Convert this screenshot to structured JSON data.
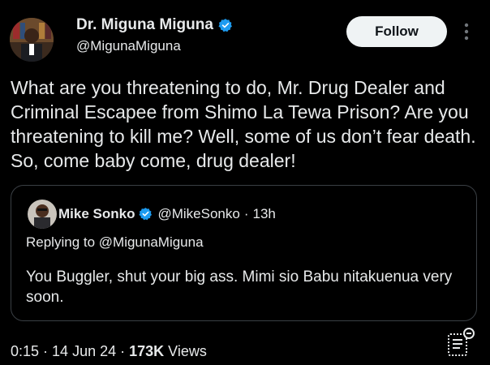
{
  "author": {
    "name": "Dr. Miguna Miguna",
    "handle": "@MigunaMiguna",
    "verified_icon": "verified-badge-icon"
  },
  "actions": {
    "follow_label": "Follow",
    "more_icon": "more-vertical-icon"
  },
  "tweet": {
    "text": "What are you threatening to do, Mr. Drug Dealer and Criminal Escapee from Shimo La Tewa Prison? Are you threatening to kill me? Well, some of us don’t fear death. So, come baby come, drug dealer!"
  },
  "quote": {
    "name": "Mike Sonko",
    "handle": "@MikeSonko",
    "separator": "·",
    "time": "13h",
    "replying": "Replying to @MigunaMiguna",
    "text": "You Buggler, shut your big ass. Mimi sio Babu nitakuenua very soon."
  },
  "meta": {
    "time": "0:15",
    "separator": "·",
    "date": "14 Jun 24",
    "views_count": "173K",
    "views_label": "Views"
  },
  "colors": {
    "background": "#000000",
    "text": "#e7e9ea",
    "verified": "#1d9bf0",
    "border": "#3a3f44",
    "follow_bg": "#eff3f4"
  }
}
